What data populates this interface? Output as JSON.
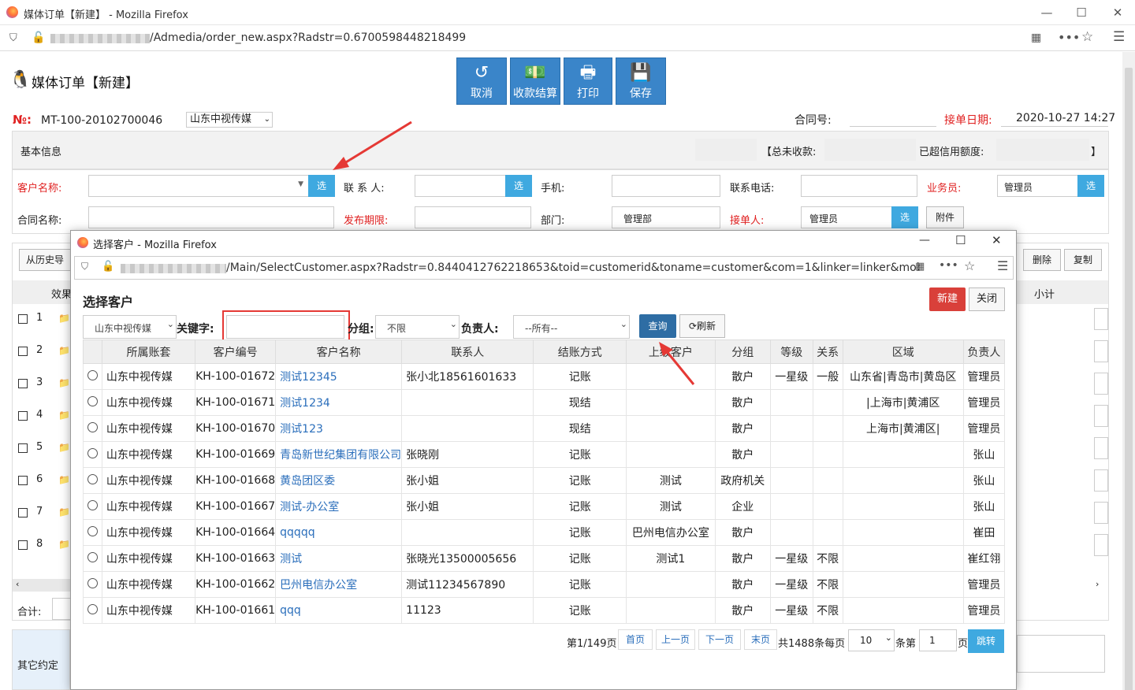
{
  "outer_window": {
    "title": "媒体订单【新建】 - Mozilla Firefox",
    "url_suffix": "/Admedia/order_new.aspx?Radstr=0.6700598448218499"
  },
  "page": {
    "heading": "媒体订单【新建】",
    "toolbar": {
      "cancel": "取消",
      "collect": "收款结算",
      "print": "打印",
      "save": "保存"
    },
    "order_no_label": "№:",
    "order_no": "MT-100-20102700046",
    "company_select": "山东中视传媒",
    "contract_no_label": "合同号:",
    "receive_date_label": "接单日期:",
    "receive_date": "2020-10-27 14:27",
    "basic_info": "基本信息",
    "unpaid_label": "【总未收款:",
    "credit_label": "已超信用额度:",
    "bracket_close": "】",
    "customer_label": "客户名称:",
    "contact_label": "联 系 人:",
    "mobile_label": "手机:",
    "phone_label": "联系电话:",
    "sales_label": "业务员:",
    "sales_value": "管理员",
    "contract_name_label": "合同名称:",
    "publish_label": "发布期限:",
    "dept_label": "部门:",
    "dept_value": "管理部",
    "receiver_label": "接单人:",
    "receiver_value": "管理员",
    "attachment": "附件",
    "select_btn": "选",
    "history_btn": "从历史导",
    "delete_btn": "删除",
    "copy_btn": "复制",
    "col_effect": "效果",
    "col_subtotal": "小计",
    "row_numbers": [
      "1",
      "2",
      "3",
      "4",
      "5",
      "6",
      "7",
      "8"
    ],
    "total_label": "合计:",
    "other_terms": "其它约定"
  },
  "popup": {
    "title": "选择客户 - Mozilla Firefox",
    "url_suffix": "/Main/SelectCustomer.aspx?Radstr=0.8440412762218653&toid=customerid&toname=customer&com=1&linker=linker&mob=mob",
    "heading": "选择客户",
    "new_btn": "新建",
    "close_btn": "关闭",
    "company_select": "山东中视传媒",
    "keyword_label": "关键字:",
    "keyword_value": "",
    "group_label": "分组:",
    "group_value": "不限",
    "owner_label": "负责人:",
    "owner_value": "--所有--",
    "query_btn": "查询",
    "refresh_btn": "刷新",
    "columns": [
      "所属账套",
      "客户编号",
      "客户名称",
      "联系人",
      "结账方式",
      "上级客户",
      "分组",
      "等级",
      "关系",
      "区域",
      "负责人"
    ],
    "rows": [
      {
        "company": "山东中视传媒",
        "code": "KH-100-01672",
        "name": "测试12345",
        "contact": "张小北18561601633",
        "settle": "记账",
        "parent": "",
        "group": "散户",
        "level": "一星级",
        "relation": "一般",
        "region": "山东省|青岛市|黄岛区",
        "owner": "管理员"
      },
      {
        "company": "山东中视传媒",
        "code": "KH-100-01671",
        "name": "测试1234",
        "contact": "",
        "settle": "现结",
        "parent": "",
        "group": "散户",
        "level": "",
        "relation": "",
        "region": "|上海市|黄浦区",
        "owner": "管理员"
      },
      {
        "company": "山东中视传媒",
        "code": "KH-100-01670",
        "name": "测试123",
        "contact": "",
        "settle": "现结",
        "parent": "",
        "group": "散户",
        "level": "",
        "relation": "",
        "region": "上海市|黄浦区|",
        "owner": "管理员"
      },
      {
        "company": "山东中视传媒",
        "code": "KH-100-01669",
        "name": "青岛新世纪集团有限公司",
        "contact": "张晓刚",
        "settle": "记账",
        "parent": "",
        "group": "散户",
        "level": "",
        "relation": "",
        "region": "",
        "owner": "张山"
      },
      {
        "company": "山东中视传媒",
        "code": "KH-100-01668",
        "name": "黄岛团区委",
        "contact": "张小姐",
        "settle": "记账",
        "parent": "测试",
        "group": "政府机关",
        "level": "",
        "relation": "",
        "region": "",
        "owner": "张山"
      },
      {
        "company": "山东中视传媒",
        "code": "KH-100-01667",
        "name": "测试-办公室",
        "contact": "张小姐",
        "settle": "记账",
        "parent": "测试",
        "group": "企业",
        "level": "",
        "relation": "",
        "region": "",
        "owner": "张山"
      },
      {
        "company": "山东中视传媒",
        "code": "KH-100-01664",
        "name": "qqqqq",
        "contact": "",
        "settle": "记账",
        "parent": "巴州电信办公室",
        "group": "散户",
        "level": "",
        "relation": "",
        "region": "",
        "owner": "崔田"
      },
      {
        "company": "山东中视传媒",
        "code": "KH-100-01663",
        "name": "测试",
        "contact": "张晓光13500005656",
        "settle": "记账",
        "parent": "测试1",
        "group": "散户",
        "level": "一星级",
        "relation": "不限",
        "region": "",
        "owner": "崔红翎"
      },
      {
        "company": "山东中视传媒",
        "code": "KH-100-01662",
        "name": "巴州电信办公室",
        "contact": "测试11234567890",
        "settle": "记账",
        "parent": "",
        "group": "散户",
        "level": "一星级",
        "relation": "不限",
        "region": "",
        "owner": "管理员"
      },
      {
        "company": "山东中视传媒",
        "code": "KH-100-01661",
        "name": "qqq",
        "contact": "11123",
        "settle": "记账",
        "parent": "",
        "group": "散户",
        "level": "一星级",
        "relation": "不限",
        "region": "",
        "owner": "管理员"
      }
    ],
    "pager": {
      "info": "第1/149页",
      "first": "首页",
      "prev": "上一页",
      "next": "下一页",
      "last": "末页",
      "total": "共1488条每页",
      "page_size": "10",
      "items_label": "条第",
      "page_input": "1",
      "page_unit": "页",
      "jump": "跳转"
    }
  },
  "colors": {
    "primary": "#3a85c9",
    "select": "#3fa9e0",
    "danger": "#d9403a",
    "required": "#e02020",
    "link": "#2a6ebb",
    "annotation": "#e53935"
  }
}
